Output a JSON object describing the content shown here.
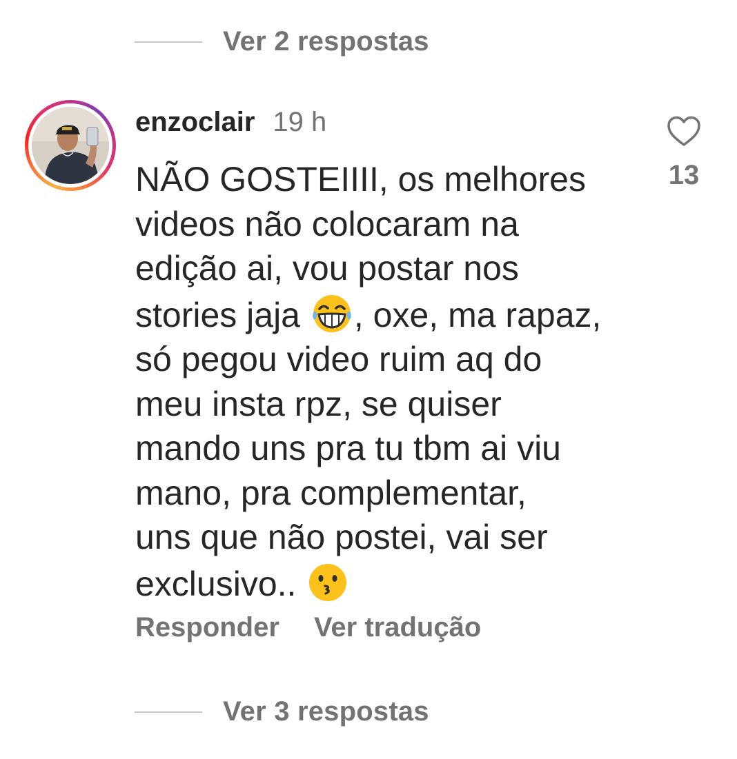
{
  "replies_top": {
    "label": "Ver 2 respostas"
  },
  "comment": {
    "username": "enzoclair",
    "time": "19 h",
    "text_lines": [
      "NÃO GOSTEIIII, os melhores",
      "videos não colocaram na",
      "edição ai, vou postar nos",
      "stories jaja ",
      ", oxe, ma rapaz,",
      "só pegou video ruim aq do",
      "meu insta rpz, se quiser",
      "mando uns pra tu tbm ai viu",
      "mano, pra complementar,",
      "uns que não postei, vai ser",
      "exclusivo.. "
    ],
    "emojis": [
      "grinning-squinting-face-with-tears",
      "kissing-face"
    ],
    "like_count": "13",
    "reply_label": "Responder",
    "translate_label": "Ver tradução"
  },
  "replies_bottom": {
    "label": "Ver 3 respostas"
  },
  "colors": {
    "text_primary": "#262626",
    "text_secondary": "#737373",
    "divider": "#c7c7c7",
    "emoji_yellow": "#fcc21b"
  }
}
